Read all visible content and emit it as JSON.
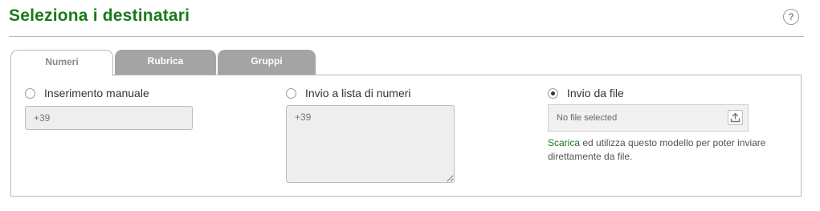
{
  "page": {
    "title": "Seleziona i destinatari",
    "help_icon": "?"
  },
  "tabs": [
    {
      "label": "Numeri",
      "active": true
    },
    {
      "label": "Rubrica",
      "active": false
    },
    {
      "label": "Gruppi",
      "active": false
    }
  ],
  "options": {
    "manual": {
      "label": "Inserimento manuale",
      "selected": false,
      "input_placeholder": "+39"
    },
    "list": {
      "label": "Invio a lista di numeri",
      "selected": false,
      "textarea_placeholder": "+39"
    },
    "file": {
      "label": "Invio da file",
      "selected": true,
      "file_status": "No file selected",
      "upload_icon": "upload-icon",
      "hint_link": "Scarica",
      "hint_text": " ed utilizza questo modello per poter inviare direttamente da file."
    }
  },
  "colors": {
    "title_green": "#1a7a1a",
    "tab_inactive": "#a4a4a4",
    "field_bg": "#eeeeee"
  }
}
